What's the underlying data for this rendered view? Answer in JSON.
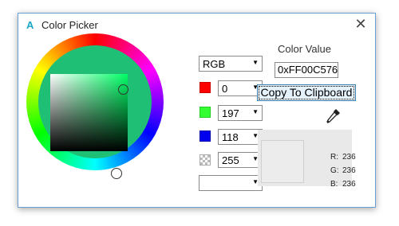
{
  "window": {
    "title": "Color Picker",
    "app_icon": "A",
    "close_glyph": "✕"
  },
  "mode": {
    "selected": "RGB"
  },
  "channels": [
    {
      "name": "red",
      "value": "0",
      "color": "#ff0000"
    },
    {
      "name": "green",
      "value": "197",
      "color": "#33ff33"
    },
    {
      "name": "blue",
      "value": "118",
      "color": "#0000ee"
    },
    {
      "name": "alpha",
      "value": "255",
      "color": "checker"
    }
  ],
  "extra_combo": {
    "value": ""
  },
  "color_value": {
    "label": "Color Value",
    "text": "0xFF00C576"
  },
  "copy_button": {
    "label": "Copy To Clipboard"
  },
  "eyedropper": {
    "icon": "eyedropper-icon"
  },
  "preview": {
    "color": "#ececec",
    "r_label": "R:",
    "r_value": "236",
    "g_label": "G:",
    "g_value": "236",
    "b_label": "B:",
    "b_value": "236"
  },
  "accent": "#1aa7c4"
}
